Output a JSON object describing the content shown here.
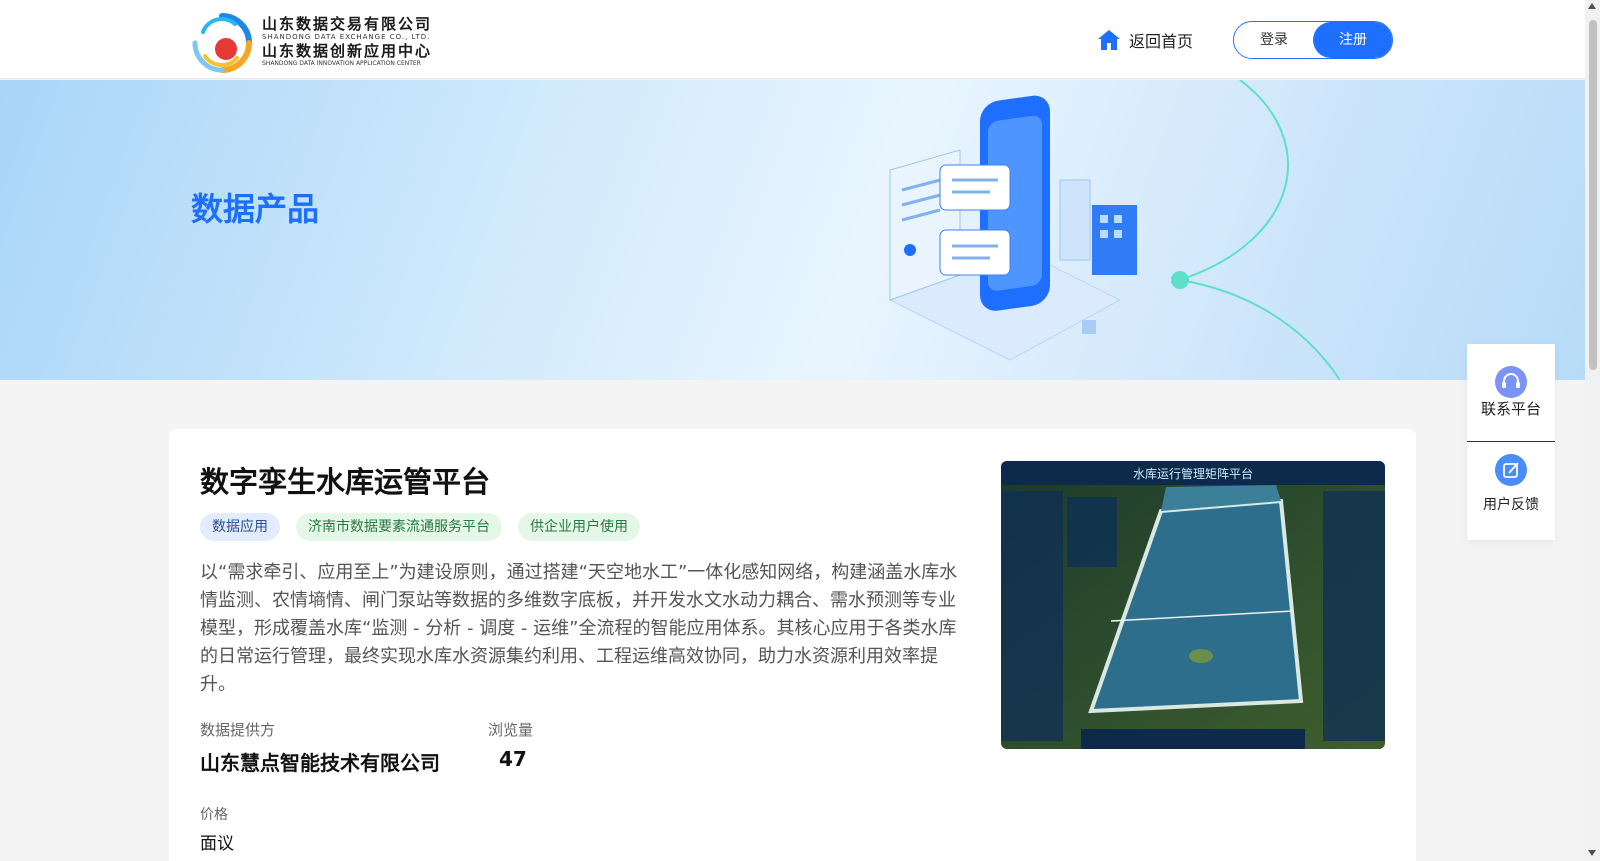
{
  "header": {
    "logo": {
      "line1": "山东数据交易有限公司",
      "sub1": "SHANDONG DATA EXCHANGE CO., LTD.",
      "line2": "山东数据创新应用中心",
      "sub2": "SHANDONG DATA INNOVATION APPLICATION CENTER"
    },
    "home_label": "返回首页",
    "login_label": "登录",
    "register_label": "注册"
  },
  "banner": {
    "title": "数据产品"
  },
  "product": {
    "title": "数字孪生水库运管平台",
    "tags": [
      "数据应用",
      "济南市数据要素流通服务平台",
      "供企业用户使用"
    ],
    "description": "以“需求牵引、应用至上”为建设原则，通过搭建“天空地水工”一体化感知网络，构建涵盖水库水情监测、农情墒情、闸门泵站等数据的多维数字底板，并开发水文水动力耦合、需水预测等专业模型，形成覆盖水库“监测 - 分析 - 调度 - 运维”全流程的智能应用体系。其核心应用于各类水库的日常运行管理，最终实现水库水资源集约利用、工程运维高效协同，助力水资源利用效率提升。",
    "provider_label": "数据提供方",
    "provider_value": "山东慧点智能技术有限公司",
    "views_label": "浏览量",
    "views_value": "47",
    "price_label": "价格",
    "price_value": "面议",
    "image_title": "水库运行管理矩阵平台"
  },
  "float_panel": {
    "contact_label": "联系平台",
    "feedback_label": "用户反馈"
  },
  "colors": {
    "brand": "#1e6fff",
    "tag_blue_bg": "#e3ecfb",
    "tag_green_bg": "#e4f7e9"
  }
}
